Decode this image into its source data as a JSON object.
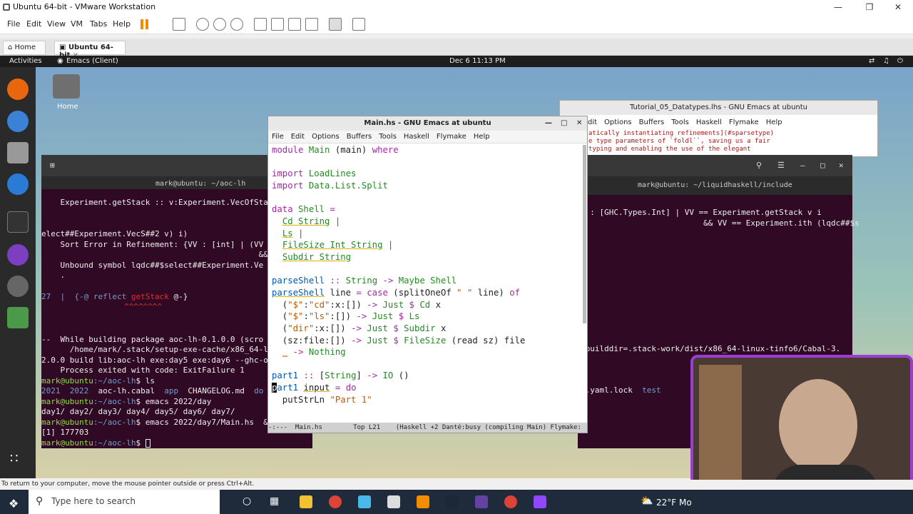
{
  "vmware": {
    "title": "Ubuntu 64-bit - VMware Workstation",
    "menu": [
      "File",
      "Edit",
      "View",
      "VM",
      "Tabs",
      "Help"
    ],
    "tabs": [
      {
        "label": "Home"
      },
      {
        "label": "Ubuntu 64-bit"
      }
    ],
    "status_text": "To return to your computer, move the mouse pointer outside or press Ctrl+Alt."
  },
  "gnome": {
    "activities": "Activities",
    "app": "Emacs (Client)",
    "clock": "Dec 6  11:13 PM",
    "home_icon_label": "Home"
  },
  "term_left": {
    "title": "mark@ubuntu: ~/aoc-lh",
    "lines": [
      "    Experiment.getStack :: v:Experiment.VecOfSta",
      "",
      "elect##Experiment.VecS##2 v) i)",
      "    Sort Error in Refinement: {VV : [int] | (VV",
      "                                              &&",
      "    Unbound symbol lqdc##$select##Experiment.Ve",
      "    ."
    ],
    "line27": "27  |  {-@ reflect ",
    "line27_fn": "getStack",
    "line27_end": " @-}",
    "carets": "^^^^^^^^",
    "build_lines": [
      "--  While building package aoc-lh-0.1.0.0 (scro",
      "      /home/mark/.stack/setup-exe-cache/x86_64-l",
      "2.0.0 build lib:aoc-lh exe:day5 exe:day6 --ghc-o",
      "    Process exited with code: ExitFailure 1"
    ],
    "prompt_user": "mark@ubuntu",
    "prompt_path": ":~/aoc-lh",
    "cmd1": "$ ls",
    "ls_2021": "2021",
    "ls_2022": "2022",
    "ls_cabal": "aoc-lh.cabal",
    "ls_app": "app",
    "ls_changelog": "CHANGELOG.md",
    "ls_do": "do",
    "cmd2": "$ emacs 2022/day",
    "days": "day1/ day2/ day3/ day4/ day5/ day6/ day7/",
    "cmd3": "$ emacs 2022/day7/Main.hs  &",
    "job": "[1] 177703",
    "cmd4": "$ "
  },
  "term_right": {
    "title": "mark@ubuntu: ~/liquidhaskell/include",
    "line1": "  : [GHC.Types.Int] | VV == Experiment.getStack v i",
    "line2": "                          && VV == Experiment.ith (lqdc##$s",
    "line3": "-builddir=.stack-work/dist/x86_64-linux-tinfo6/Cabal-3.",
    "line4a": "k.yaml.lock",
    "line4b": "test"
  },
  "emacs_tut": {
    "title": "Tutorial_05_Datatypes.lhs - GNU Emacs at ubuntu",
    "menu": [
      "dit",
      "Options",
      "Buffers",
      "Tools",
      "Haskell",
      "Flymake",
      "Help"
    ],
    "lines": [
      "atically instantiating refinements](#sparsetype)",
      "e type parameters of `foldl``, saving us a fair",
      "typing and enabling the use of the elegant"
    ]
  },
  "emacs_main": {
    "title": "Main.hs - GNU Emacs at ubuntu",
    "menu": [
      "File",
      "Edit",
      "Options",
      "Buffers",
      "Tools",
      "Haskell",
      "Flymake",
      "Help"
    ],
    "modeline": "-:---  Main.hs        Top L21    (Haskell +2 Danté:busy (compiling Main) Flymake:"
  },
  "taskbar": {
    "search_placeholder": "Type here to search",
    "weather": "22°F  Mo"
  },
  "colors": {
    "terminal_bg": "#300a24",
    "prompt_green": "#8ae234",
    "path_blue": "#729fcf",
    "webcam_border": "#9b3dd0",
    "taskbar": "#1f2a3a"
  }
}
